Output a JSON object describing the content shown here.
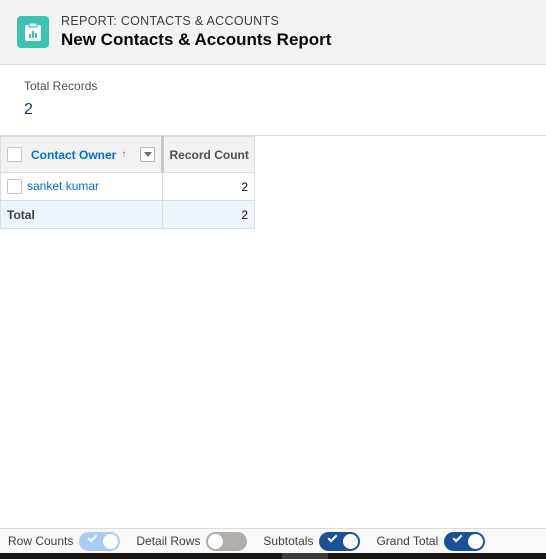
{
  "header": {
    "subtitle": "REPORT: CONTACTS & ACCOUNTS",
    "title": "New Contacts & Accounts Report",
    "icon": "report-clipboard-icon",
    "icon_color": "#3bc4b4"
  },
  "summary": {
    "label": "Total Records",
    "value": "2"
  },
  "table": {
    "columns": [
      {
        "label": "Contact Owner",
        "sort": "ascending",
        "sort_glyph": "↑"
      },
      {
        "label": "Record Count"
      }
    ],
    "rows": [
      {
        "owner": "sanket kumar",
        "count": "2"
      }
    ],
    "total": {
      "label": "Total",
      "count": "2"
    }
  },
  "footer": {
    "toggles": [
      {
        "label": "Row Counts",
        "state": "on-disabled"
      },
      {
        "label": "Detail Rows",
        "state": "off"
      },
      {
        "label": "Subtotals",
        "state": "on"
      },
      {
        "label": "Grand Total",
        "state": "on"
      }
    ]
  },
  "colors": {
    "link": "#0070d2",
    "toggle_on": "#1b5297",
    "toggle_disabled": "#a9cdf2",
    "toggle_off": "#b0adab"
  }
}
